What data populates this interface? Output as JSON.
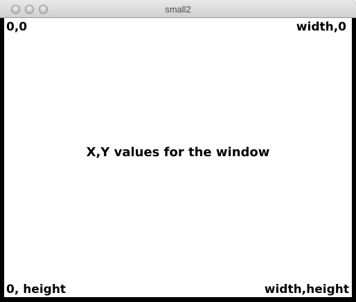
{
  "window": {
    "title": "small2"
  },
  "canvas": {
    "top_left_label": "0,0",
    "top_right_label": "width,0",
    "center_label": "X,Y values for the window",
    "bottom_left_label": "0, height",
    "bottom_right_label": "width,height"
  }
}
